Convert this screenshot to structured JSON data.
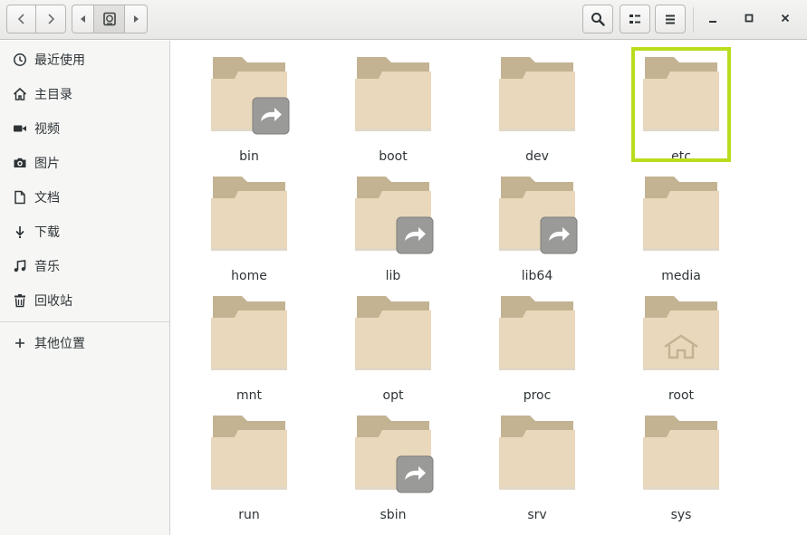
{
  "colors": {
    "folder_tab": "#c3b393",
    "folder_body": "#e9d8bb",
    "folder_shadow": "#c8b797",
    "selection": "#b9dc1c",
    "emblem_bg": "#9a9a98"
  },
  "toolbar": {
    "back_icon": "chevron-left-icon",
    "forward_icon": "chevron-right-icon",
    "path_prev_icon": "triangle-left-icon",
    "path_location_icon": "drive-icon",
    "path_next_icon": "triangle-right-icon",
    "search_icon": "search-icon",
    "view_icon": "list-view-icon",
    "menu_icon": "hamburger-menu-icon",
    "minimize_icon": "minimize-icon",
    "maximize_icon": "maximize-icon",
    "close_icon": "close-icon"
  },
  "sidebar": {
    "items": [
      {
        "label": "最近使用",
        "icon": "clock-icon"
      },
      {
        "label": "主目录",
        "icon": "home-icon"
      },
      {
        "label": "视频",
        "icon": "video-icon"
      },
      {
        "label": "图片",
        "icon": "camera-icon"
      },
      {
        "label": "文档",
        "icon": "document-icon"
      },
      {
        "label": "下载",
        "icon": "download-icon"
      },
      {
        "label": "音乐",
        "icon": "music-icon"
      },
      {
        "label": "回收站",
        "icon": "trash-icon"
      }
    ],
    "other_locations": {
      "label": "其他位置",
      "icon": "plus-icon"
    }
  },
  "files": [
    {
      "name": "bin",
      "symlink": true,
      "home": false,
      "selected": false
    },
    {
      "name": "boot",
      "symlink": false,
      "home": false,
      "selected": false
    },
    {
      "name": "dev",
      "symlink": false,
      "home": false,
      "selected": false
    },
    {
      "name": "etc",
      "symlink": false,
      "home": false,
      "selected": true
    },
    {
      "name": "home",
      "symlink": false,
      "home": false,
      "selected": false
    },
    {
      "name": "lib",
      "symlink": true,
      "home": false,
      "selected": false
    },
    {
      "name": "lib64",
      "symlink": true,
      "home": false,
      "selected": false
    },
    {
      "name": "media",
      "symlink": false,
      "home": false,
      "selected": false
    },
    {
      "name": "mnt",
      "symlink": false,
      "home": false,
      "selected": false
    },
    {
      "name": "opt",
      "symlink": false,
      "home": false,
      "selected": false
    },
    {
      "name": "proc",
      "symlink": false,
      "home": false,
      "selected": false
    },
    {
      "name": "root",
      "symlink": false,
      "home": true,
      "selected": false
    },
    {
      "name": "run",
      "symlink": false,
      "home": false,
      "selected": false
    },
    {
      "name": "sbin",
      "symlink": true,
      "home": false,
      "selected": false
    },
    {
      "name": "srv",
      "symlink": false,
      "home": false,
      "selected": false
    },
    {
      "name": "sys",
      "symlink": false,
      "home": false,
      "selected": false
    }
  ]
}
